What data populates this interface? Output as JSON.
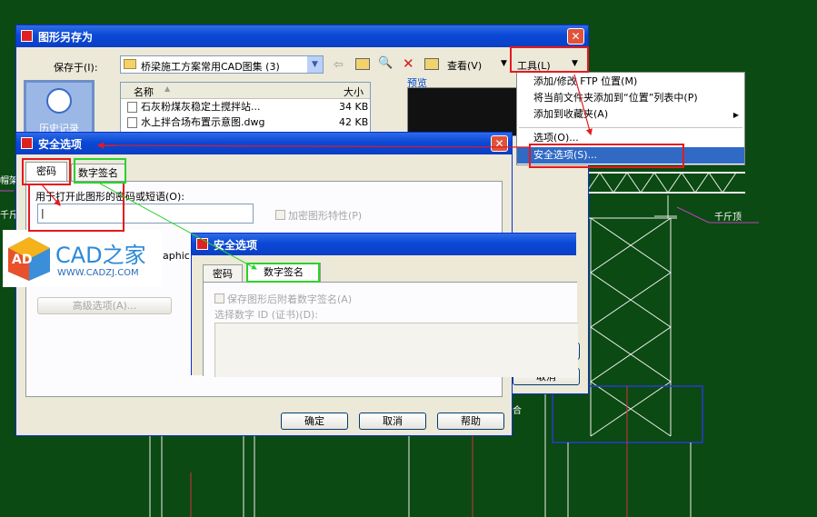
{
  "background": {
    "color": "#0b4a12",
    "cad_labels": [
      "千斤顶",
      "帽架",
      "千斤",
      "合"
    ]
  },
  "save_dialog": {
    "title": "图形另存为",
    "save_in_label": "保存于(I):",
    "folder": "桥梁施工方案常用CAD图集 (3)",
    "view_label": "查看(V)",
    "tools_label": "工具(L)",
    "preview_label": "预览",
    "history_label": "历史记录",
    "columns": {
      "name": "名称",
      "size": "大小"
    },
    "files": [
      {
        "name": "石灰粉煤灰稳定土搅拌站...",
        "size": "34 KB"
      },
      {
        "name": "水上拌合场布置示意图.dwg",
        "size": "42 KB"
      }
    ],
    "cancel_partial": "取消"
  },
  "tools_menu": {
    "items": [
      {
        "label": "添加/修改 FTP 位置(M)"
      },
      {
        "label": "将当前文件夹添加到“位置”列表中(P)"
      },
      {
        "label": "添加到收藏夹(A)",
        "submenu": true
      },
      {
        "label": "选项(O)..."
      },
      {
        "label": "安全选项(S)...",
        "selected": true
      }
    ]
  },
  "security_dialog_1": {
    "title": "安全选项",
    "tabs": [
      "密码",
      "数字签名"
    ],
    "password_prompt": "用于打开此图形的密码或短语(O):",
    "password_value": "|",
    "encrypt_props": "加密图形特性(P)",
    "partial_text": "aphic",
    "advanced_button": "高级选项(A)...",
    "ok": "确定",
    "cancel": "取消",
    "help": "帮助"
  },
  "security_dialog_2": {
    "title": "安全选项",
    "tabs": [
      "密码",
      "数字签名"
    ],
    "attach_signature": "保存图形后附着数字签名(A)",
    "select_id": "选择数字 ID (证书)(D):"
  },
  "watermark": {
    "brand": "CAD之家",
    "url": "WWW.CADZJ.COM",
    "logo_text": "AD"
  },
  "colors": {
    "annotation_red": "#e5191f",
    "annotation_green": "#2ed02e",
    "xp_blue": "#0a48d6"
  }
}
